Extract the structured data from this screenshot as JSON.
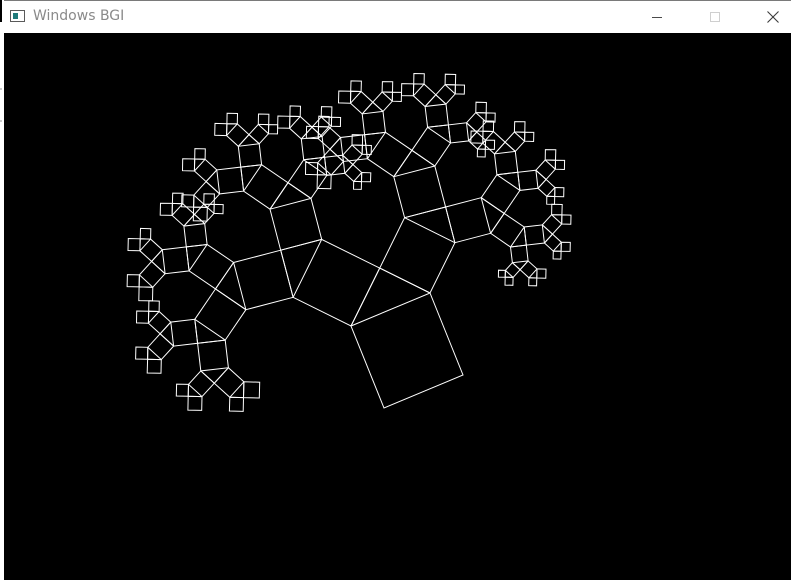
{
  "window": {
    "title": "Windows BGI",
    "controls": {
      "minimize_icon": "minimize-icon",
      "maximize_icon": "maximize-icon",
      "close_icon": "close-icon"
    }
  },
  "canvas": {
    "background": "#000000",
    "stroke": "#ffffff",
    "fractal": "pythagoras-tree",
    "depth": 6,
    "left_angle_deg": 41
  }
}
